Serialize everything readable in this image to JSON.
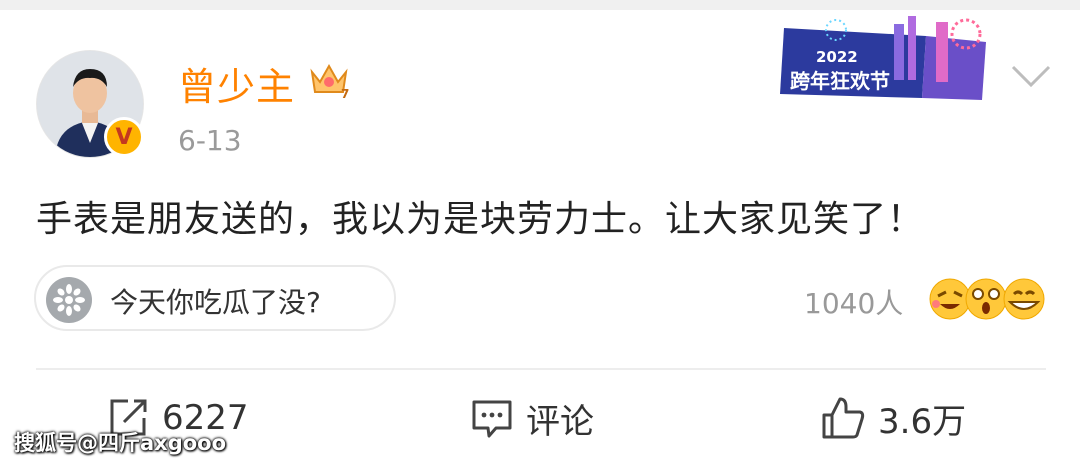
{
  "post": {
    "author": "曾少主",
    "date": "6-13",
    "verified_badge": "V",
    "banner_year": "2022",
    "banner_title": "跨年狂欢节",
    "content": "手表是朋友送的，我以为是块劳力士。让大家见笑了！"
  },
  "topic": {
    "label": "今天你吃瓜了没?",
    "count": "1040人"
  },
  "actions": {
    "repost_count": "6227",
    "comment_label": "评论",
    "like_count": "3.6万"
  },
  "watermark": "搜狐号@四斤axgooo",
  "colors": {
    "author_name": "#ff8200",
    "badge": "#ffb400",
    "text": "#222222",
    "muted": "#9a9a9a"
  }
}
